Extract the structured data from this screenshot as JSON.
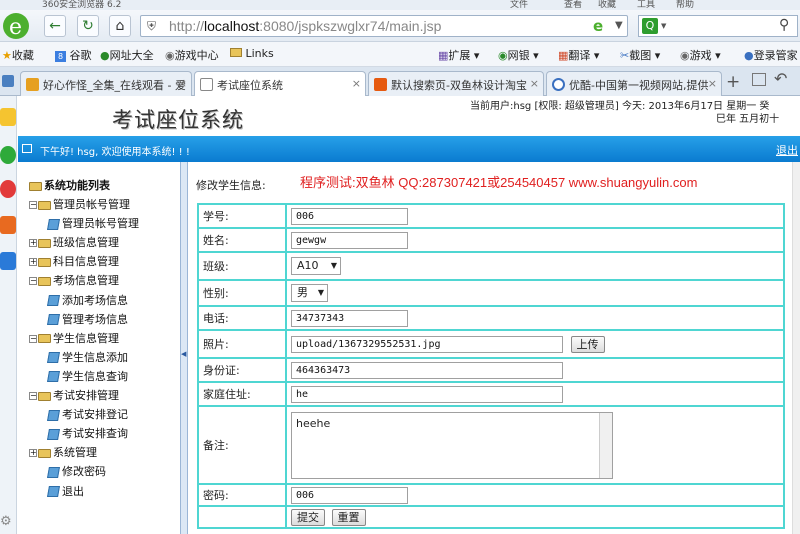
{
  "browser": {
    "title": "360安全浏览器 6.2",
    "menu": [
      "文件",
      "查看",
      "收藏",
      "工具",
      "帮助"
    ],
    "url_host": "localhost",
    "url_rest": ":8080/jspkszwglxr74/main.jsp",
    "url_prefix": "http://",
    "bookmarks": [
      "收藏",
      "谷歌",
      "网址大全",
      "游戏中心",
      "Links"
    ],
    "toolbar_right": [
      "扩展",
      "网银",
      "翻译",
      "截图",
      "游戏",
      "登录管家"
    ],
    "tabs": [
      {
        "label": "好心作怪_全集_在线观看 - 爱"
      },
      {
        "label": "考试座位系统"
      },
      {
        "label": "默认搜索页-双鱼林设计淘宝"
      },
      {
        "label": "优酷-中国第一视频网站,提供"
      }
    ],
    "colors": {
      "accent": "#0a7bd0",
      "table_border": "#4fd6d2",
      "credit": "#e02020"
    }
  },
  "app": {
    "title": "考试座位系统",
    "user_line1": "当前用户:hsg [权限: 超级管理员] 今天:  2013年6月17日 星期一 癸",
    "user_line2": "巳年 五月初十",
    "welcome": "下午好! hsg, 欢迎使用本系统! ! !",
    "logout": "退出"
  },
  "tree": {
    "root": "系统功能列表",
    "items": [
      {
        "label": "管理员帐号管理",
        "type": "folder"
      },
      {
        "label": "管理员帐号管理",
        "type": "page"
      },
      {
        "label": "班级信息管理",
        "type": "folder"
      },
      {
        "label": "科目信息管理",
        "type": "folder"
      },
      {
        "label": "考场信息管理",
        "type": "folder"
      },
      {
        "label": "添加考场信息",
        "type": "page"
      },
      {
        "label": "管理考场信息",
        "type": "page"
      },
      {
        "label": "学生信息管理",
        "type": "folder"
      },
      {
        "label": "学生信息添加",
        "type": "page"
      },
      {
        "label": "学生信息查询",
        "type": "page"
      },
      {
        "label": "考试安排管理",
        "type": "folder"
      },
      {
        "label": "考试安排登记",
        "type": "page"
      },
      {
        "label": "考试安排查询",
        "type": "page"
      },
      {
        "label": "系统管理",
        "type": "folder"
      },
      {
        "label": "修改密码",
        "type": "page"
      },
      {
        "label": "退出",
        "type": "page"
      }
    ]
  },
  "form": {
    "heading": "修改学生信息:",
    "credit": "程序测试:双鱼林 QQ:287307421或254540457 www.shuangyulin.com",
    "fields": {
      "student_no": {
        "label": "学号:",
        "value": "006"
      },
      "name": {
        "label": "姓名:",
        "value": "gewgw"
      },
      "class": {
        "label": "班级:",
        "value": "A10"
      },
      "gender": {
        "label": "性别:",
        "value": "男"
      },
      "phone": {
        "label": "电话:",
        "value": "34737343"
      },
      "photo": {
        "label": "照片:",
        "value": "upload/1367329552531.jpg",
        "button": "上传"
      },
      "id_card": {
        "label": "身份证:",
        "value": "464363473"
      },
      "address": {
        "label": "家庭住址:",
        "value": "he"
      },
      "remark": {
        "label": "备注:",
        "value": "heehe"
      },
      "password": {
        "label": "密码:",
        "value": "006"
      }
    },
    "submit": "提交",
    "reset": "重置"
  }
}
